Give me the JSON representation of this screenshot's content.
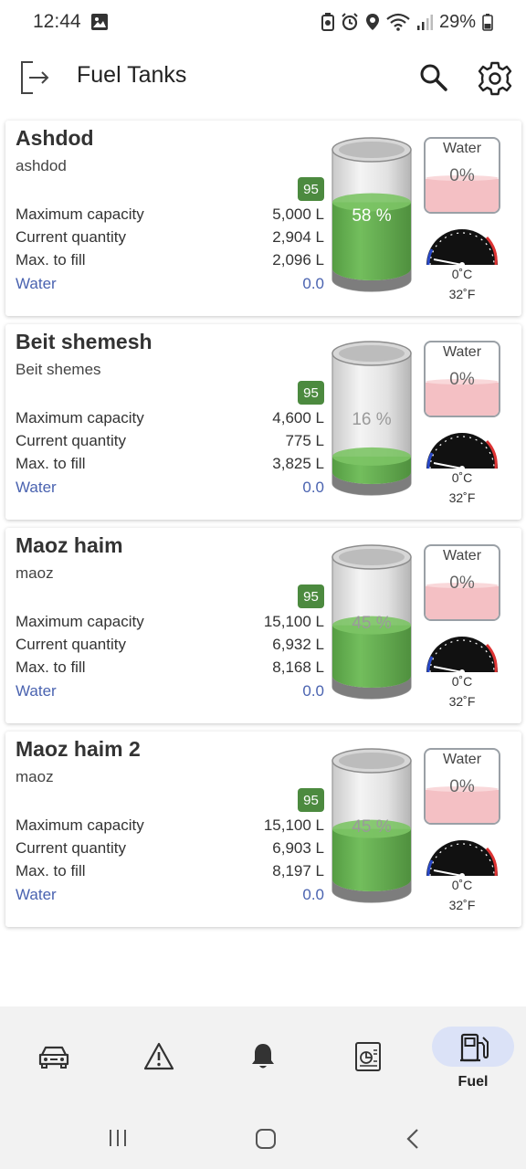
{
  "status": {
    "time": "12:44",
    "battery": "29%",
    "icons": [
      "image-icon",
      "battery-saver-icon",
      "alarm-icon",
      "location-icon",
      "wifi-icon",
      "signal-icon",
      "battery-icon"
    ]
  },
  "appbar": {
    "title": "Fuel Tanks",
    "icons": [
      "logout-icon",
      "search-icon",
      "settings-gear-icon"
    ]
  },
  "labels": {
    "max_capacity": "Maximum capacity",
    "current_quantity": "Current quantity",
    "max_to_fill": "Max. to fill",
    "water": "Water"
  },
  "tanks": [
    {
      "name": "Ashdod",
      "subtitle": "ashdod",
      "grade": "95",
      "max_capacity": "5,000 L",
      "current_quantity": "2,904 L",
      "max_to_fill": "2,096 L",
      "water_value": "0.0",
      "fill_percent_label": "58 %",
      "fill_fraction": 0.58,
      "water_gauge_label": "Water",
      "water_percent": "0%",
      "temp_c": "0˚C",
      "temp_f": "32˚F"
    },
    {
      "name": "Beit shemesh",
      "subtitle": "Beit shemes",
      "grade": "95",
      "max_capacity": "4,600 L",
      "current_quantity": "775 L",
      "max_to_fill": "3,825 L",
      "water_value": "0.0",
      "fill_percent_label": "16 %",
      "fill_fraction": 0.16,
      "water_gauge_label": "Water",
      "water_percent": "0%",
      "temp_c": "0˚C",
      "temp_f": "32˚F"
    },
    {
      "name": "Maoz haim",
      "subtitle": "maoz",
      "grade": "95",
      "max_capacity": "15,100 L",
      "current_quantity": "6,932 L",
      "max_to_fill": "8,168 L",
      "water_value": "0.0",
      "fill_percent_label": "45 %",
      "fill_fraction": 0.45,
      "water_gauge_label": "Water",
      "water_percent": "0%",
      "temp_c": "0˚C",
      "temp_f": "32˚F"
    },
    {
      "name": "Maoz haim 2",
      "subtitle": "maoz",
      "grade": "95",
      "max_capacity": "15,100 L",
      "current_quantity": "6,903 L",
      "max_to_fill": "8,197 L",
      "water_value": "0.0",
      "fill_percent_label": "45 %",
      "fill_fraction": 0.45,
      "water_gauge_label": "Water",
      "water_percent": "0%",
      "temp_c": "0˚C",
      "temp_f": "32˚F"
    }
  ],
  "bottom_nav": {
    "items": [
      {
        "icon": "car-icon",
        "label": ""
      },
      {
        "icon": "warning-icon",
        "label": ""
      },
      {
        "icon": "bell-icon",
        "label": ""
      },
      {
        "icon": "report-icon",
        "label": ""
      },
      {
        "icon": "fuel-pump-icon",
        "label": "Fuel",
        "active": true
      }
    ]
  },
  "system_nav": {
    "icons": [
      "recent-apps-icon",
      "home-icon",
      "back-icon"
    ]
  },
  "colors": {
    "fuel_green": "#5fa84a",
    "grade_badge": "#4c8a3f",
    "water_pink": "#f4c0c4",
    "link_blue": "#4a63b0",
    "active_nav_pill": "#dbe2f7"
  }
}
